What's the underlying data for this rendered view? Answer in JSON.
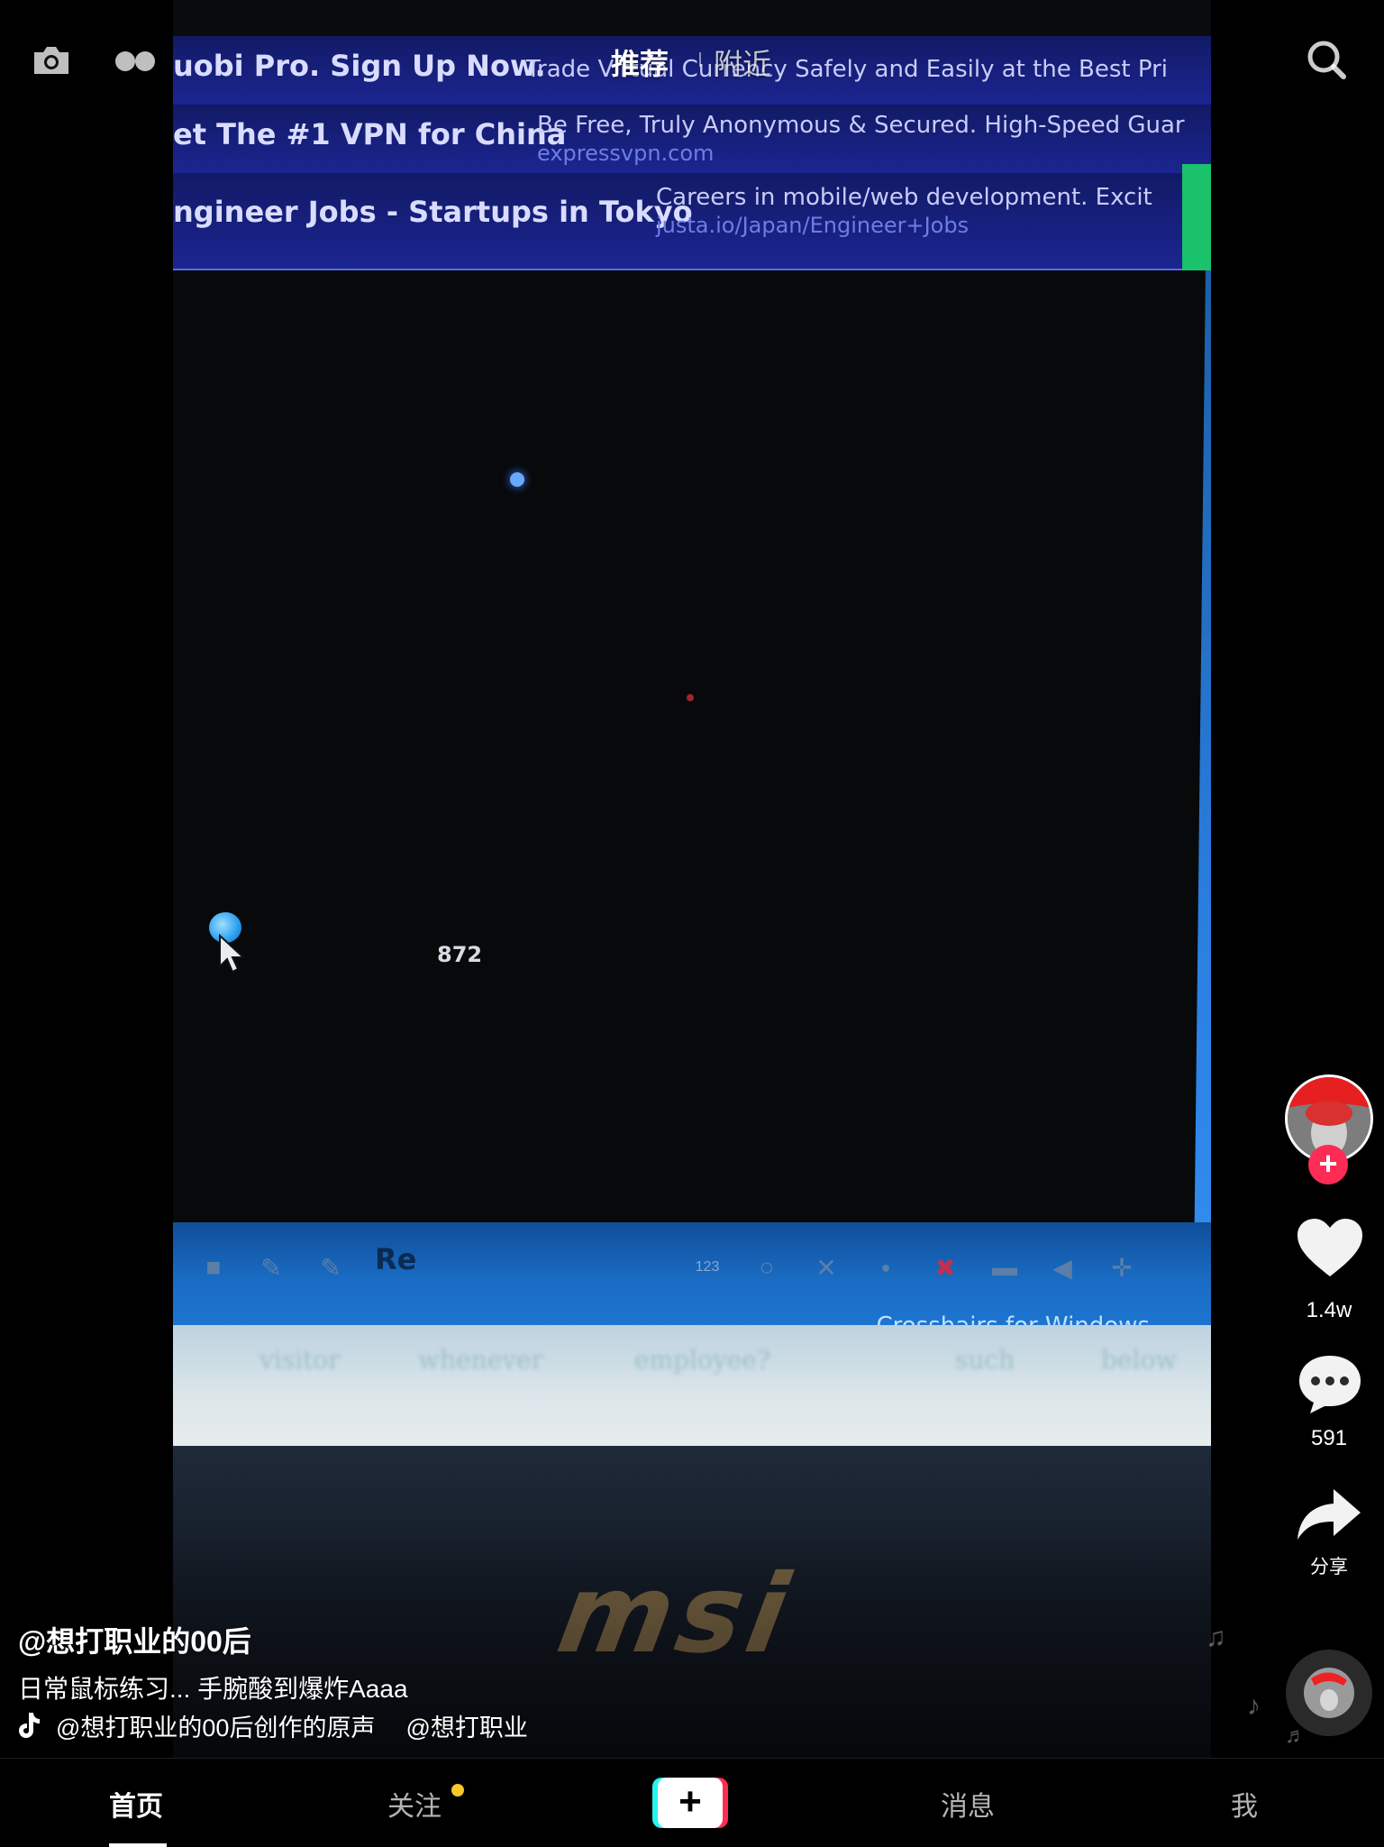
{
  "top_nav": {
    "tabs": [
      {
        "label": "推荐",
        "active": true
      },
      {
        "label": "附近",
        "active": false
      }
    ],
    "left_icons": [
      "camera-icon",
      "live-icon"
    ],
    "right_icon": "search-icon"
  },
  "video": {
    "ads": [
      {
        "title": "uobi Pro. Sign Up Now.",
        "desc": "Trade Virtual Currency Safely and Easily at the Best Pri"
      },
      {
        "title": "et The #1 VPN for China",
        "desc": "Be Free, Truly Anonymous & Secured. High-Speed Guar",
        "url": "expressvpn.com"
      },
      {
        "title": "ngineer Jobs - Startups in Tokyo",
        "desc": "Careers in mobile/web development. Excit",
        "url": "justa.io/Japan/Engineer+Jobs"
      }
    ],
    "score": "872",
    "toolbar_re": "Re",
    "toolbar_counter": "123",
    "toolbar_caption": "Crosshairs for Windows",
    "lower_strip_words": [
      "visitor",
      "whenever",
      "employee?",
      "such",
      "below"
    ],
    "brand": "msi"
  },
  "right_rail": {
    "likes": "1.4w",
    "comments": "591",
    "share_label": "分享"
  },
  "caption": {
    "author": "@想打职业的00后",
    "description": "日常鼠标练习... 手腕酸到爆炸Aaaa",
    "sound": "@想打职业的00后创作的原声",
    "sound_extra": "@想打职业"
  },
  "bottom_nav": {
    "home": "首页",
    "follow": "关注",
    "messages": "消息",
    "me": "我"
  },
  "colors": {
    "accent_red": "#fe2c55",
    "accent_cyan": "#25f4ee",
    "notify_dot": "#f8c825"
  }
}
